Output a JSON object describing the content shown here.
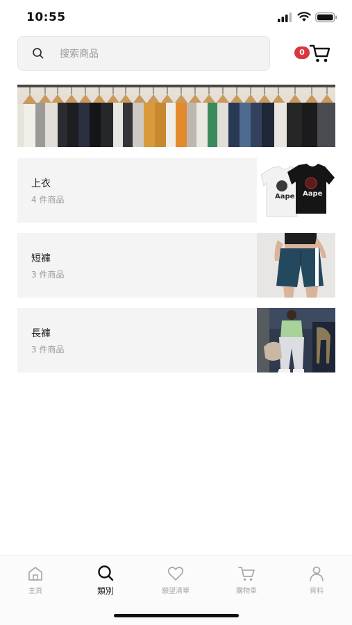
{
  "status_bar": {
    "time": "10:55"
  },
  "search": {
    "placeholder": "搜索商品",
    "icon": "search-icon"
  },
  "cart": {
    "badge_count": "0",
    "icon": "cart-icon",
    "badge_color": "#d9363e"
  },
  "banner": {
    "description_icon": "clothes-rack-banner"
  },
  "categories": [
    {
      "name": "上衣",
      "count": "4 件商品"
    },
    {
      "name": "短褲",
      "count": "3 件商品"
    },
    {
      "name": "長褲",
      "count": "3 件商品"
    }
  ],
  "tabbar": {
    "items": [
      {
        "label": "主頁",
        "icon": "home-icon",
        "active": false
      },
      {
        "label": "類別",
        "icon": "search-icon",
        "active": true
      },
      {
        "label": "願望清單",
        "icon": "heart-icon",
        "active": false
      },
      {
        "label": "購物車",
        "icon": "cart-icon",
        "active": false
      },
      {
        "label": "資料",
        "icon": "profile-icon",
        "active": false
      }
    ]
  }
}
